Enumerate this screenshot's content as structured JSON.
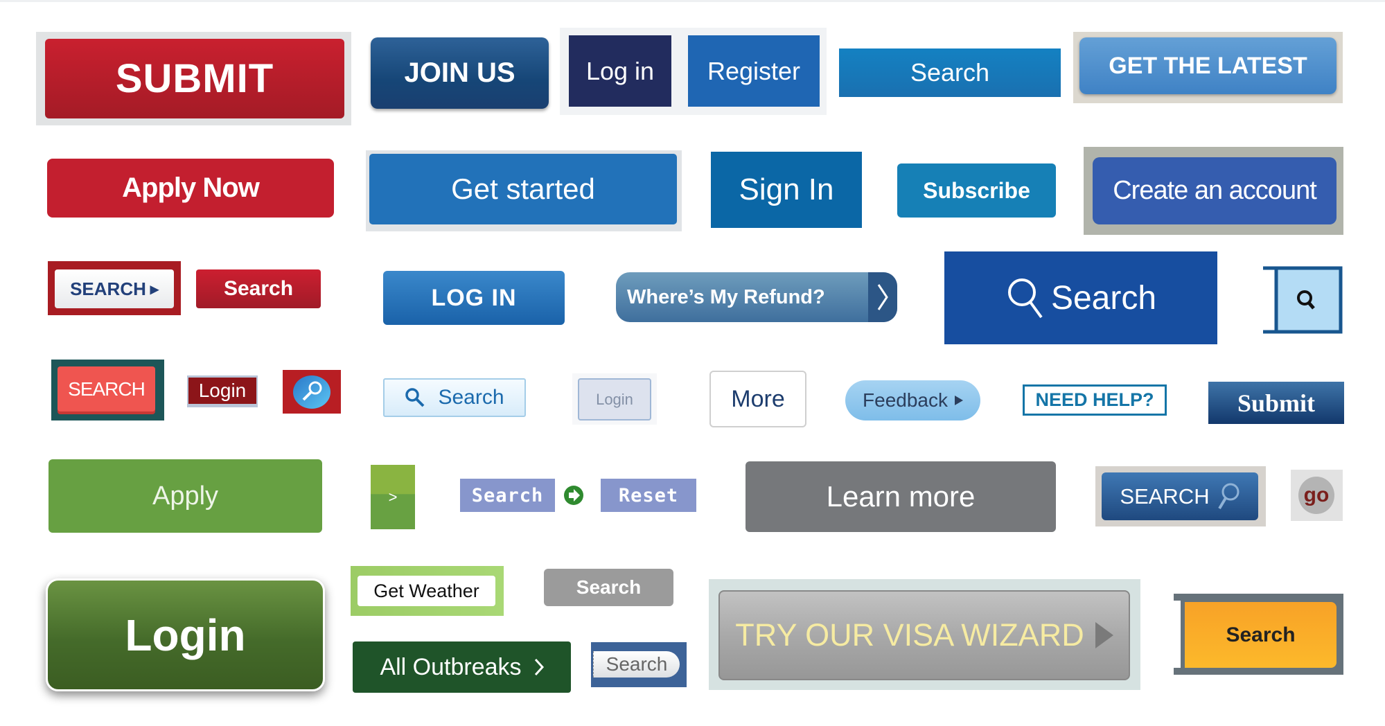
{
  "buttons": {
    "submit": "SUBMIT",
    "join_us": "JOIN US",
    "log_in": "Log in",
    "register": "Register",
    "search_blue": "Search",
    "get_the_latest": "GET THE LATEST",
    "apply_now": "Apply Now",
    "get_started": "Get started",
    "sign_in": "Sign In",
    "subscribe": "Subscribe",
    "create_account": "Create an account",
    "search_arrow": "SEARCH",
    "search_red": "Search",
    "log_in_caps": "LOG IN",
    "wheres_my_refund": "Where’s My Refund?",
    "search_big": "Search",
    "search_teal": "SEARCH",
    "login_maroon": "Login",
    "search_light": "Search",
    "login_gray": "Login",
    "more": "More",
    "feedback": "Feedback",
    "need_help": "NEED HELP?",
    "submit_serif": "Submit",
    "apply": "Apply",
    "greater": ">",
    "search_purple": "Search",
    "reset": "Reset",
    "learn_more": "Learn more",
    "search_blue_mag": "SEARCH",
    "go": "go",
    "login_big": "Login",
    "get_weather": "Get Weather",
    "search_gray": "Search",
    "all_outbreaks": "All Outbreaks",
    "search_pill": "Search",
    "visa_wizard": "TRY OUR VISA WIZARD",
    "search_orange": "Search"
  },
  "icons": {
    "arrow_right": "▸",
    "chevron": "›",
    "magnifier": "search-icon",
    "go_arrow": "green-arrow-icon"
  },
  "colors": {
    "red": "#c31f2f",
    "navy": "#222c5e",
    "blue": "#2272b9",
    "royal_blue": "#174ea0",
    "green": "#67a042",
    "dark_green": "#1f5429",
    "gray": "#76787b",
    "orange": "#f8a227"
  }
}
